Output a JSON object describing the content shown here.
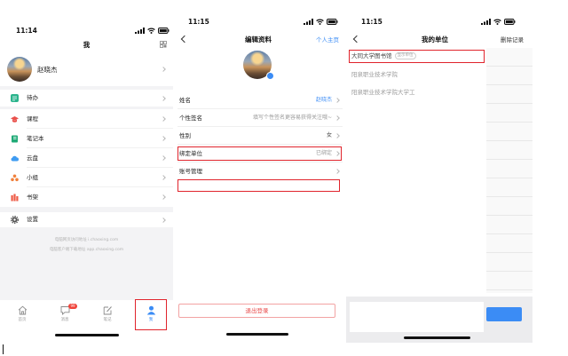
{
  "theme": {
    "accent": "#3b8cf5",
    "highlight": "#e0242c",
    "logout": "#e84a4a",
    "text_muted": "#9a9a9a"
  },
  "screens": {
    "me": {
      "status_time": "11:14",
      "title": "我",
      "profile_name": "赵晓杰",
      "todo": {
        "label": "待办",
        "icon": "todo-icon",
        "color": "#2bb48c"
      },
      "menu_items": [
        {
          "label": "课程",
          "icon": "graduation-cap-icon",
          "color": "#e9514c"
        },
        {
          "label": "笔记本",
          "icon": "notebook-icon",
          "color": "#1faa76"
        },
        {
          "label": "云盘",
          "icon": "cloud-icon",
          "color": "#3f9cf2"
        },
        {
          "label": "小组",
          "icon": "group-icon",
          "color": "#f0803c"
        },
        {
          "label": "书架",
          "icon": "bookshelf-icon",
          "color": "#ee5a45"
        }
      ],
      "settings": {
        "label": "设置",
        "icon": "gear-icon",
        "color": "#555555"
      },
      "footer_lines": [
        "电脑网页访问地址 i.chaoxing.com",
        "电脑客户端下载地址 app.chaoxing.com"
      ],
      "tabs": [
        {
          "label": "首页",
          "icon": "home-icon"
        },
        {
          "label": "消息",
          "icon": "message-icon",
          "badge": "99"
        },
        {
          "label": "笔记",
          "icon": "note-edit-icon"
        },
        {
          "label": "我",
          "icon": "person-icon"
        }
      ]
    },
    "edit_profile": {
      "status_time": "11:15",
      "title": "编辑资料",
      "homepage_link": "个人主页",
      "rows": [
        {
          "label": "姓名",
          "value": "赵晓杰"
        },
        {
          "label": "个性签名",
          "value": "填写个性签名更容易获得关注哦~"
        },
        {
          "label": "性别",
          "value": "女"
        },
        {
          "label": "绑定单位",
          "value": "已绑定"
        },
        {
          "label": "账号管理"
        }
      ],
      "logout_label": "退出登录"
    },
    "my_units": {
      "status_time": "11:15",
      "title": "我的单位",
      "delete_records": "删除记录",
      "units": [
        {
          "name": "大同大学图书馆",
          "tag": "显示单位"
        },
        {
          "name": "阳泉职业技术学院"
        },
        {
          "name": "阳泉职业技术学院大学工"
        }
      ]
    }
  }
}
